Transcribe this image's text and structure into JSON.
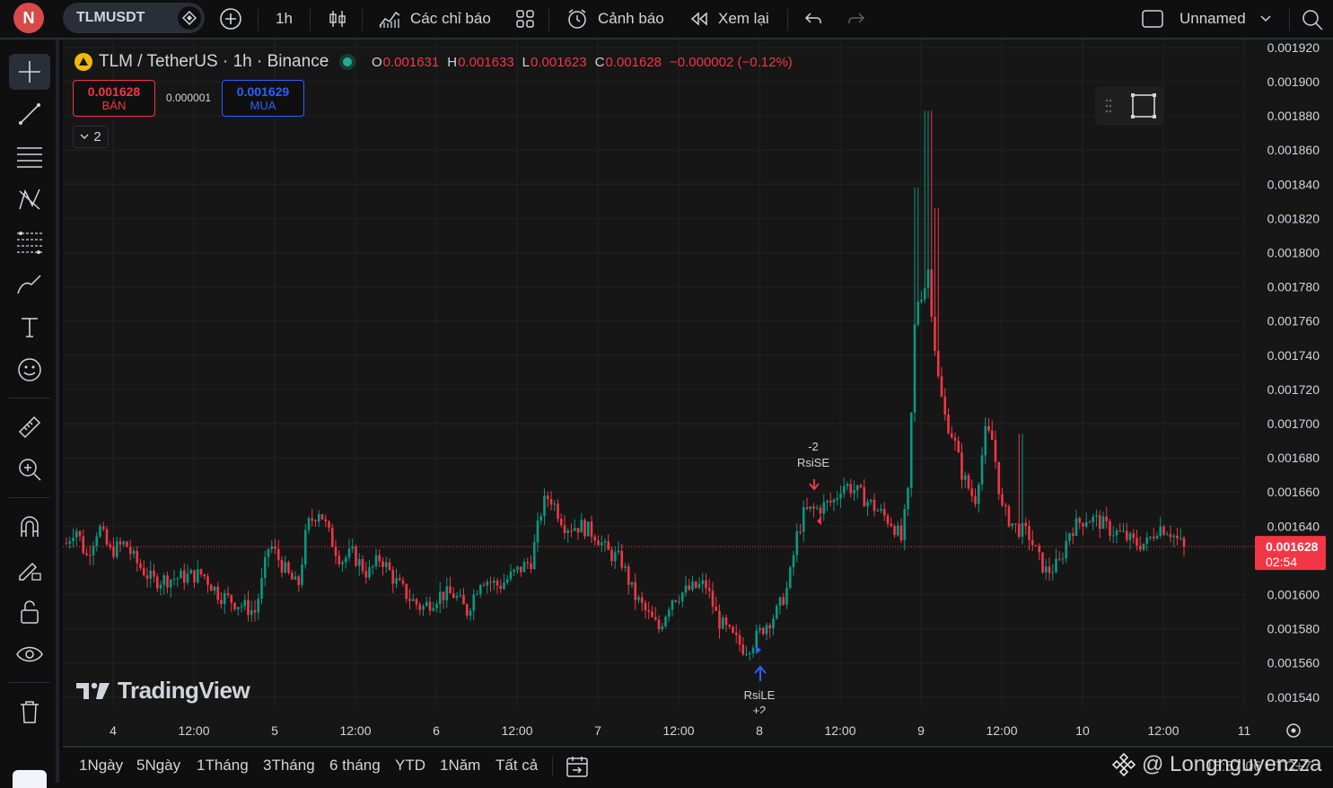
{
  "topbar": {
    "avatar_letter": "N",
    "symbol": "TLMUSDT",
    "interval": "1h",
    "indicators_label": "Các chỉ báo",
    "alerts_label": "Cảnh báo",
    "replay_label": "Xem lại",
    "layout_name": "Unnamed"
  },
  "legend": {
    "title": "TLM / TetherUS · 1h · Binance",
    "o_label": "O",
    "o_value": "0.001631",
    "h_label": "H",
    "h_value": "0.001633",
    "l_label": "L",
    "l_value": "0.001623",
    "c_label": "C",
    "c_value": "0.001628",
    "change": "−0.000002 (−0.12%)"
  },
  "trade": {
    "sell_price": "0.001628",
    "sell_label": "BÁN",
    "spread": "0.000001",
    "buy_price": "0.001629",
    "buy_label": "MUA",
    "collapse_count": "2"
  },
  "signals": {
    "short_qty": "-2",
    "short_label": "RsiSE",
    "long_label": "RsiLE",
    "long_qty": "+2"
  },
  "price_axis": {
    "ticks": [
      "0.001920",
      "0.001900",
      "0.001880",
      "0.001860",
      "0.001840",
      "0.001820",
      "0.001800",
      "0.001780",
      "0.001760",
      "0.001740",
      "0.001720",
      "0.001700",
      "0.001680",
      "0.001660",
      "0.001640",
      "0.001600",
      "0.001580",
      "0.001560",
      "0.001540"
    ],
    "current_price": "0.001628",
    "countdown": "02:54"
  },
  "time_axis": {
    "ticks": [
      "4",
      "12:00",
      "5",
      "12:00",
      "6",
      "12:00",
      "7",
      "12:00",
      "8",
      "12:00",
      "9",
      "12:00",
      "10",
      "12:00",
      "11"
    ]
  },
  "watermark": "TradingView",
  "bottombar": {
    "ranges": [
      "1Ngày",
      "5Ngày",
      "1Tháng",
      "3Tháng",
      "6 tháng",
      "YTD",
      "1Năm",
      "Tất cả"
    ],
    "clock": "15:57:06 UTC+7",
    "overlay_handle": "@ Longnguyenzza"
  },
  "colors": {
    "up": "#089981",
    "down": "#f23645",
    "buy": "#2962ff",
    "background": "#161616"
  }
}
